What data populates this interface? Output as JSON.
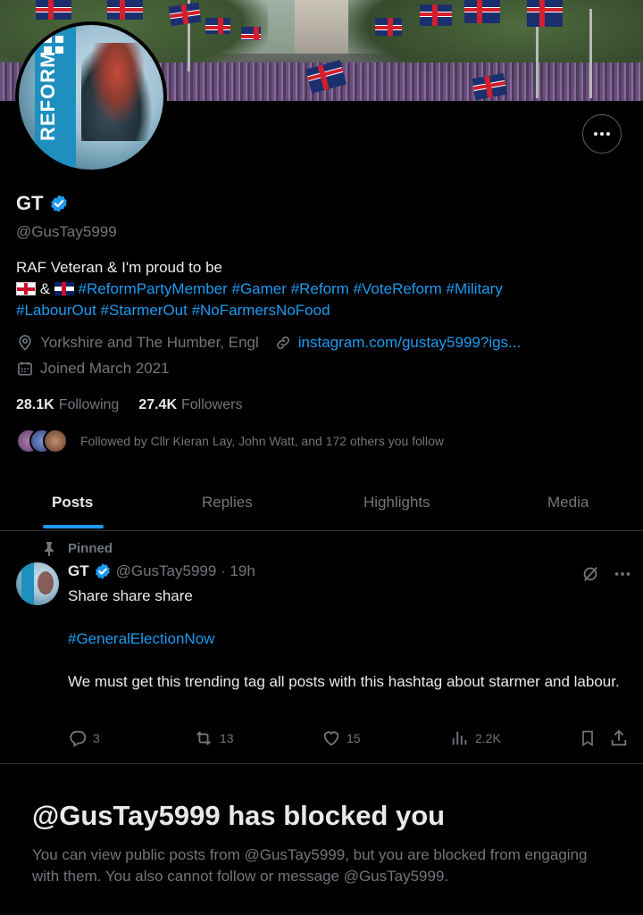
{
  "profile": {
    "name": "GT",
    "handle": "@GusTay5999",
    "bio_line1": "RAF Veteran & I'm proud to be",
    "bio_amp": "&",
    "hashtags": [
      "#ReformPartyMember",
      "#Gamer",
      "#Reform",
      "#VoteReform",
      "#Military",
      "#LabourOut",
      "#StarmerOut",
      "#NoFarmersNoFood"
    ],
    "location": "Yorkshire and The Humber, Engl",
    "website": "instagram.com/gustay5999?igs...",
    "joined": "Joined March 2021",
    "following_count": "28.1K",
    "following_label": "Following",
    "followers_count": "27.4K",
    "followers_label": "Followers",
    "followed_by": "Followed by Cllr Kieran Lay, John Watt, and 172 others you follow",
    "avatar_text": "REFORM"
  },
  "tabs": [
    "Posts",
    "Replies",
    "Highlights",
    "Media"
  ],
  "active_tab": "Posts",
  "post": {
    "pinned_label": "Pinned",
    "author_name": "GT",
    "author_handle_time": "@GusTay5999 · 19h",
    "line1": "Share share share",
    "hashtag": "#GeneralElectionNow",
    "line3": "We must get this trending tag all posts with this hashtag about starmer and labour.",
    "replies": "3",
    "reposts": "13",
    "likes": "15",
    "views": "2.2K"
  },
  "blocked": {
    "title": "@GusTay5999 has blocked you",
    "message": "You can view public posts from @GusTay5999, but you are blocked from engaging with them. You also cannot follow or message @GusTay5999."
  },
  "colors": {
    "accent": "#1d9bf0",
    "muted": "#71767b",
    "text": "#e7e9ea",
    "background": "#000000"
  }
}
